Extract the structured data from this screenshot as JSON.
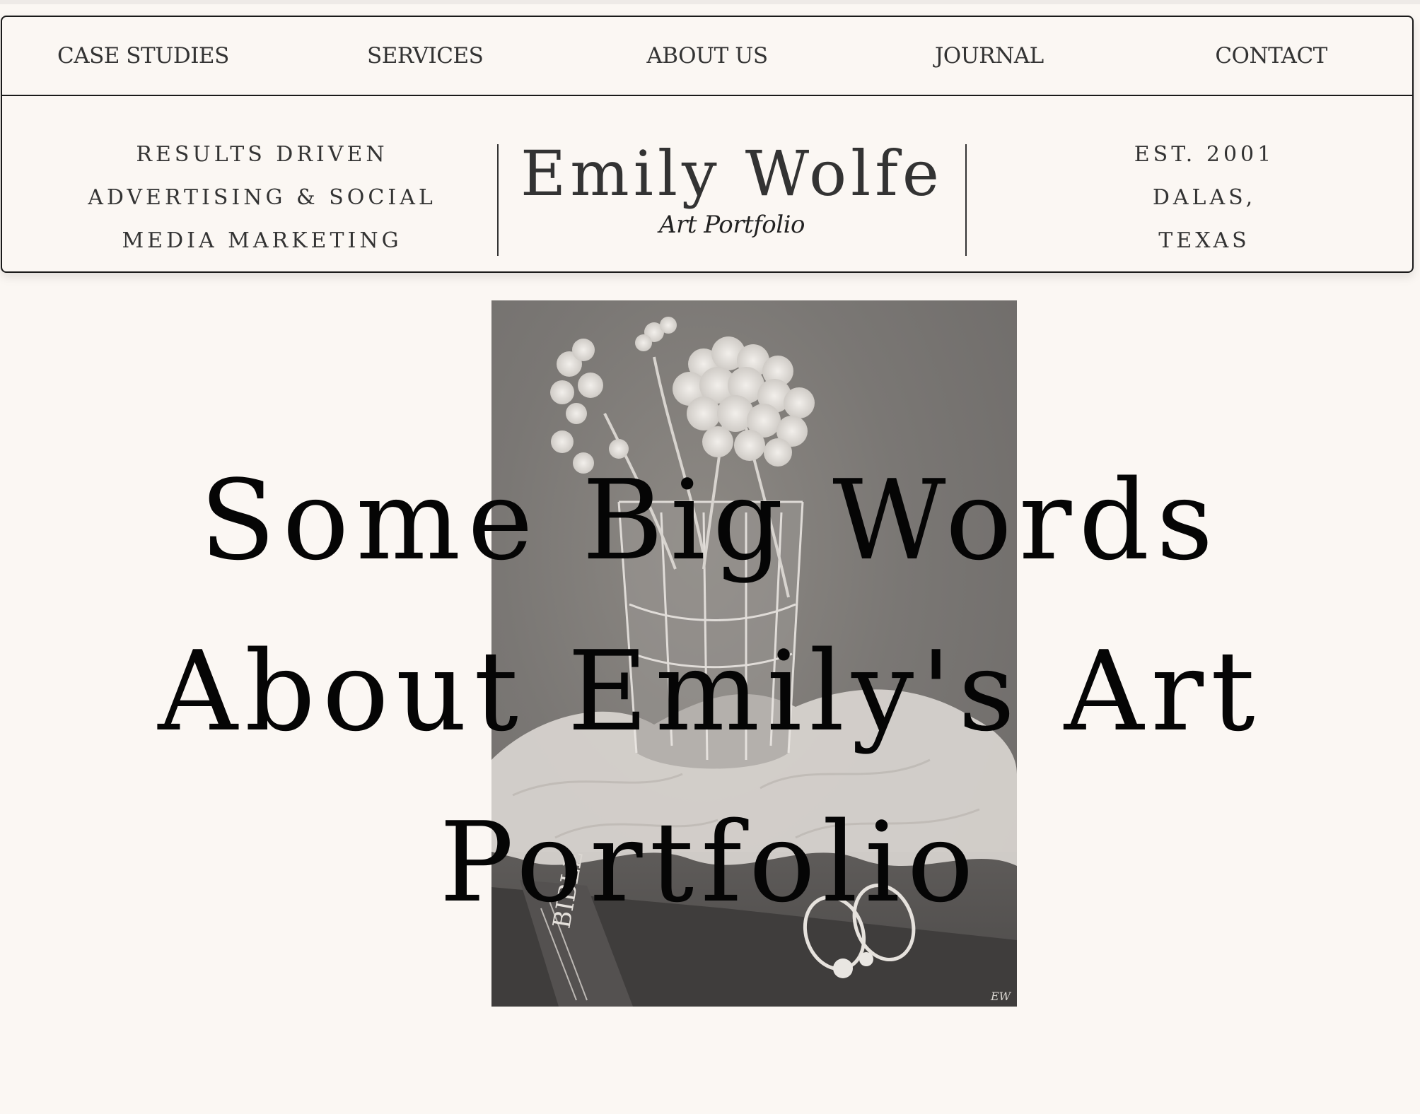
{
  "nav": {
    "items": [
      {
        "label": "CASE STUDIES"
      },
      {
        "label": "SERVICES"
      },
      {
        "label": "ABOUT US"
      },
      {
        "label": "JOURNAL"
      },
      {
        "label": "CONTACT"
      }
    ]
  },
  "brand": {
    "tagline_left": [
      "RESULTS DRIVEN",
      "ADVERTISING & SOCIAL",
      "MEDIA MARKETING"
    ],
    "name": "Emily Wolfe",
    "subtitle": "Art Portfolio",
    "tagline_right": [
      "EST. 2001",
      "DALAS,",
      "TEXAS"
    ]
  },
  "artwork": {
    "book_spine_text": "BIBLE",
    "signature": "EW"
  },
  "hero": {
    "lines": [
      "Some Big Words",
      "About Emily's Art",
      "Portfolio"
    ]
  },
  "colors": {
    "background": "#fbf7f3",
    "text": "#333333",
    "hero_text": "#050505",
    "border": "#1a1a1a"
  }
}
